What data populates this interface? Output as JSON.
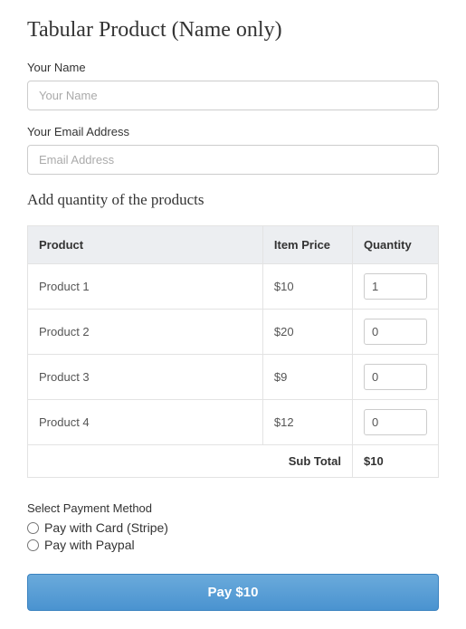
{
  "title": "Tabular Product (Name only)",
  "fields": {
    "name": {
      "label": "Your Name",
      "placeholder": "Your Name",
      "value": ""
    },
    "email": {
      "label": "Your Email Address",
      "placeholder": "Email Address",
      "value": ""
    }
  },
  "products_section": {
    "heading": "Add quantity of the products",
    "columns": {
      "product": "Product",
      "price": "Item Price",
      "quantity": "Quantity"
    },
    "rows": [
      {
        "name": "Product 1",
        "price": "$10",
        "quantity": "1"
      },
      {
        "name": "Product 2",
        "price": "$20",
        "quantity": "0"
      },
      {
        "name": "Product 3",
        "price": "$9",
        "quantity": "0"
      },
      {
        "name": "Product 4",
        "price": "$12",
        "quantity": "0"
      }
    ],
    "subtotal_label": "Sub Total",
    "subtotal_value": "$10"
  },
  "payment": {
    "title": "Select Payment Method",
    "options": [
      "Pay with Card (Stripe)",
      "Pay with Paypal"
    ]
  },
  "button_label": "Pay $10"
}
